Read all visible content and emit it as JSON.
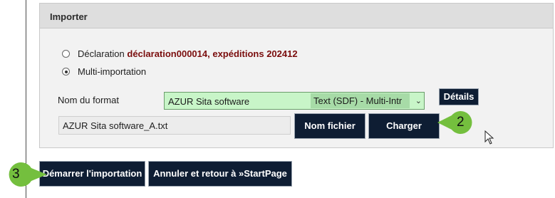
{
  "panel": {
    "title": "Importer"
  },
  "options": [
    {
      "label": "Déclaration",
      "detail": "déclaration000014, expéditions 202412",
      "selected": false
    },
    {
      "label": "Multi-importation",
      "detail": "",
      "selected": true
    }
  ],
  "format": {
    "label": "Nom du format",
    "selected_name": "AZUR Sita software",
    "selected_type": "Text (SDF) - Multi-Intr",
    "details_button": "Détails"
  },
  "file": {
    "value": "AZUR Sita software_A.txt",
    "filename_button": "Nom fichier",
    "load_button": "Charger"
  },
  "footer": {
    "start_button": "Démarrer l'importation",
    "cancel_button": "Annuler et retour à »StartPage"
  },
  "callouts": {
    "load_step": "2",
    "start_step": "3"
  },
  "colors": {
    "button_bg": "#0e1d33",
    "select_bg": "#c8f5c8",
    "callout": "#74bf3e",
    "highlight_text": "#7a0d0d"
  }
}
